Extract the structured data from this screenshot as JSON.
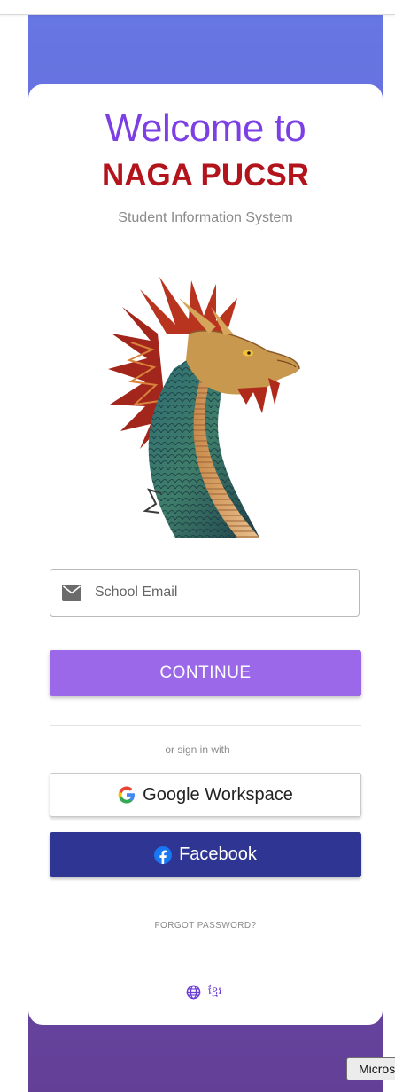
{
  "header": {
    "welcome": "Welcome to",
    "brand": "NAGA PUCSR",
    "subtitle": "Student Information System"
  },
  "login": {
    "email_placeholder": "School Email",
    "continue_label": "CONTINUE",
    "divider_text": "or sign in with",
    "google_label": "Google Workspace",
    "facebook_label": "Facebook",
    "forgot_label": "FORGOT PASSWORD?"
  },
  "language": {
    "icon": "globe-icon",
    "khmer_label": "ខ្មែរ"
  },
  "taskbar": {
    "label": "Micros"
  },
  "icons": {
    "mail": "mail-icon",
    "google": "google-logo-icon",
    "facebook": "facebook-logo-icon",
    "mascot": "dragon-illustration"
  },
  "colors": {
    "accent": "#9b68ea",
    "brand": "#b3141c",
    "welcome": "#7b3fe4",
    "facebook": "#2e3592"
  }
}
